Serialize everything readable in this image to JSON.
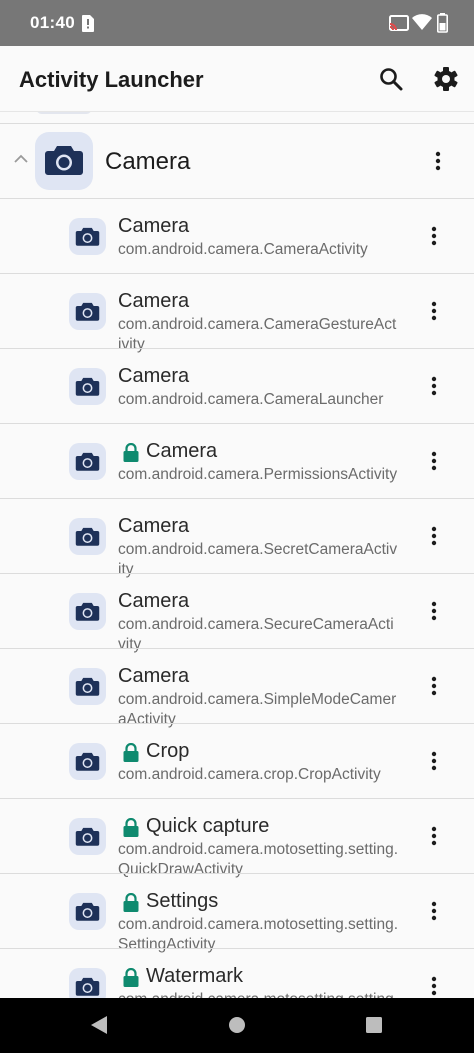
{
  "status_bar": {
    "time": "01:40",
    "icons": [
      "sim-alert-icon",
      "cast-icon",
      "wifi-icon",
      "battery-icon"
    ]
  },
  "app_bar": {
    "title": "Activity Launcher",
    "actions": [
      "search-icon",
      "settings-gear-icon"
    ]
  },
  "group": {
    "title": "Camera",
    "expanded": true,
    "icon": "camera-icon"
  },
  "items": [
    {
      "title": "Camera",
      "subtitle": "com.android.camera.CameraActivity",
      "locked": false
    },
    {
      "title": "Camera",
      "subtitle": "com.android.camera.CameraGestureActivity",
      "locked": false
    },
    {
      "title": "Camera",
      "subtitle": "com.android.camera.CameraLauncher",
      "locked": false
    },
    {
      "title": "Camera",
      "subtitle": "com.android.camera.PermissionsActivity",
      "locked": true
    },
    {
      "title": "Camera",
      "subtitle": "com.android.camera.SecretCameraActivity",
      "locked": false
    },
    {
      "title": "Camera",
      "subtitle": "com.android.camera.SecureCameraActivity",
      "locked": false
    },
    {
      "title": "Camera",
      "subtitle": "com.android.camera.SimpleModeCameraActivity",
      "locked": false
    },
    {
      "title": "Crop",
      "subtitle": "com.android.camera.crop.CropActivity",
      "locked": true
    },
    {
      "title": "Quick capture",
      "subtitle": "com.android.camera.motosetting.setting.QuickDrawActivity",
      "locked": true
    },
    {
      "title": "Settings",
      "subtitle": "com.android.camera.motosetting.setting.SettingActivity",
      "locked": true
    },
    {
      "title": "Watermark",
      "subtitle": "com.android.camera.motosetting.setting",
      "locked": true
    }
  ],
  "nav_bar": {
    "buttons": [
      "back-icon",
      "home-icon",
      "recents-icon"
    ]
  },
  "colors": {
    "status_bar": "#777777",
    "background": "#fafafa",
    "icon_tint": "#1e3158",
    "icon_bg": "#dfe5f3",
    "lock": "#0f8a6f"
  }
}
